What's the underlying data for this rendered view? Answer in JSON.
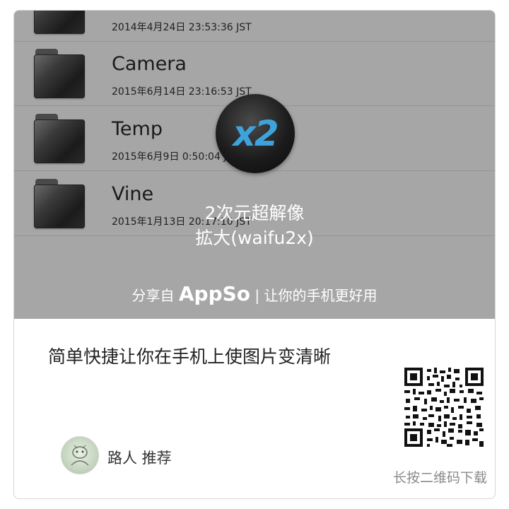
{
  "files": [
    {
      "name": "",
      "date": "2014年4月24日 23:53:36 JST"
    },
    {
      "name": "Camera",
      "date": "2015年6月14日 23:16:53 JST"
    },
    {
      "name": "Temp",
      "date": "2015年6月9日 0:50:04 JST"
    },
    {
      "name": "Vine",
      "date": "2015年1月13日 20:17:10 JST"
    }
  ],
  "app": {
    "icon_text": "x2",
    "title_line1": "2次元超解像",
    "title_line2": "拡大(waifu2x)"
  },
  "share": {
    "prefix": "分享自",
    "brand": "AppSo",
    "suffix": "| 让你的手机更好用"
  },
  "article": {
    "headline": "简单快捷让你在手机上使图片变清晰"
  },
  "recommender": {
    "text": "路人 推荐"
  },
  "qr": {
    "caption": "长按二维码下载"
  },
  "colors": {
    "preview_bg": "#a6a6a6",
    "badge_accent": "#3ea3dd"
  }
}
